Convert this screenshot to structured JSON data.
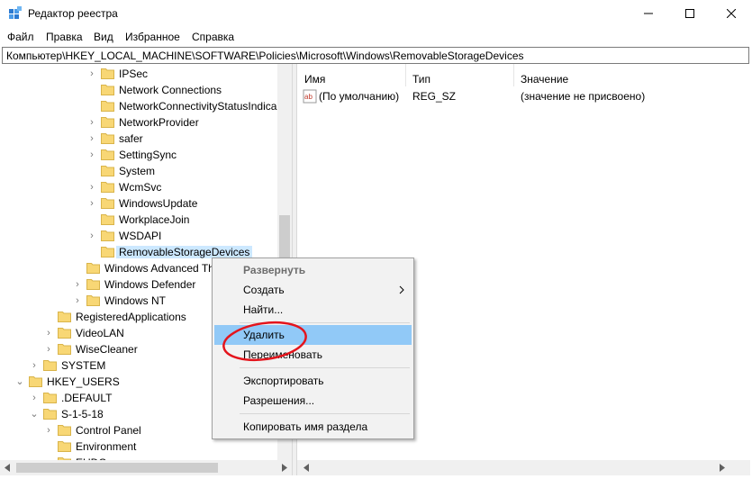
{
  "window": {
    "title": "Редактор реестра",
    "minimize_icon": "minimize-icon",
    "maximize_icon": "maximize-icon",
    "close_icon": "close-icon"
  },
  "menu": [
    "Файл",
    "Правка",
    "Вид",
    "Избранное",
    "Справка"
  ],
  "address": "Компьютер\\HKEY_LOCAL_MACHINE\\SOFTWARE\\Policies\\Microsoft\\Windows\\RemovableStorageDevices",
  "tree": [
    {
      "label": "IPSec",
      "arrow": "›"
    },
    {
      "label": "Network Connections",
      "arrow": ""
    },
    {
      "label": "NetworkConnectivityStatusIndica",
      "arrow": ""
    },
    {
      "label": "NetworkProvider",
      "arrow": "›"
    },
    {
      "label": "safer",
      "arrow": "›"
    },
    {
      "label": "SettingSync",
      "arrow": "›"
    },
    {
      "label": "System",
      "arrow": ""
    },
    {
      "label": "WcmSvc",
      "arrow": "›"
    },
    {
      "label": "WindowsUpdate",
      "arrow": "›"
    },
    {
      "label": "WorkplaceJoin",
      "arrow": ""
    },
    {
      "label": "WSDAPI",
      "arrow": "›"
    },
    {
      "label": "RemovableStorageDevices",
      "arrow": ""
    },
    {
      "label": "Windows Advanced Th",
      "arrow": ""
    },
    {
      "label": "Windows Defender",
      "arrow": "›"
    },
    {
      "label": "Windows NT",
      "arrow": "›"
    },
    {
      "label": "RegisteredApplications",
      "arrow": ""
    },
    {
      "label": "VideoLAN",
      "arrow": "›"
    },
    {
      "label": "WiseCleaner",
      "arrow": "›"
    },
    {
      "label": "SYSTEM",
      "arrow": "›"
    },
    {
      "label": "HKEY_USERS",
      "arrow": "⌄"
    },
    {
      "label": ".DEFAULT",
      "arrow": "›"
    },
    {
      "label": "S-1-5-18",
      "arrow": "⌄"
    },
    {
      "label": "Control Panel",
      "arrow": "›"
    },
    {
      "label": "Environment",
      "arrow": ""
    },
    {
      "label": "EUDC",
      "arrow": ""
    }
  ],
  "list": {
    "columns": [
      "Имя",
      "Тип",
      "Значение"
    ],
    "rows": [
      {
        "icon": "ab",
        "name": "(По умолчанию)",
        "type": "REG_SZ",
        "value": "(значение не присвоено)"
      }
    ]
  },
  "context_menu": {
    "expand": "Развернуть",
    "create": "Создать",
    "find": "Найти...",
    "delete": "Удалить",
    "rename": "Переименовать",
    "export": "Экспортировать",
    "permissions": "Разрешения...",
    "copy_key_name": "Копировать имя раздела"
  },
  "colors": {
    "folder": "#f8d775",
    "selection": "#cce8ff",
    "menu_highlight": "#91c9f7",
    "annotation": "#e4141c"
  }
}
